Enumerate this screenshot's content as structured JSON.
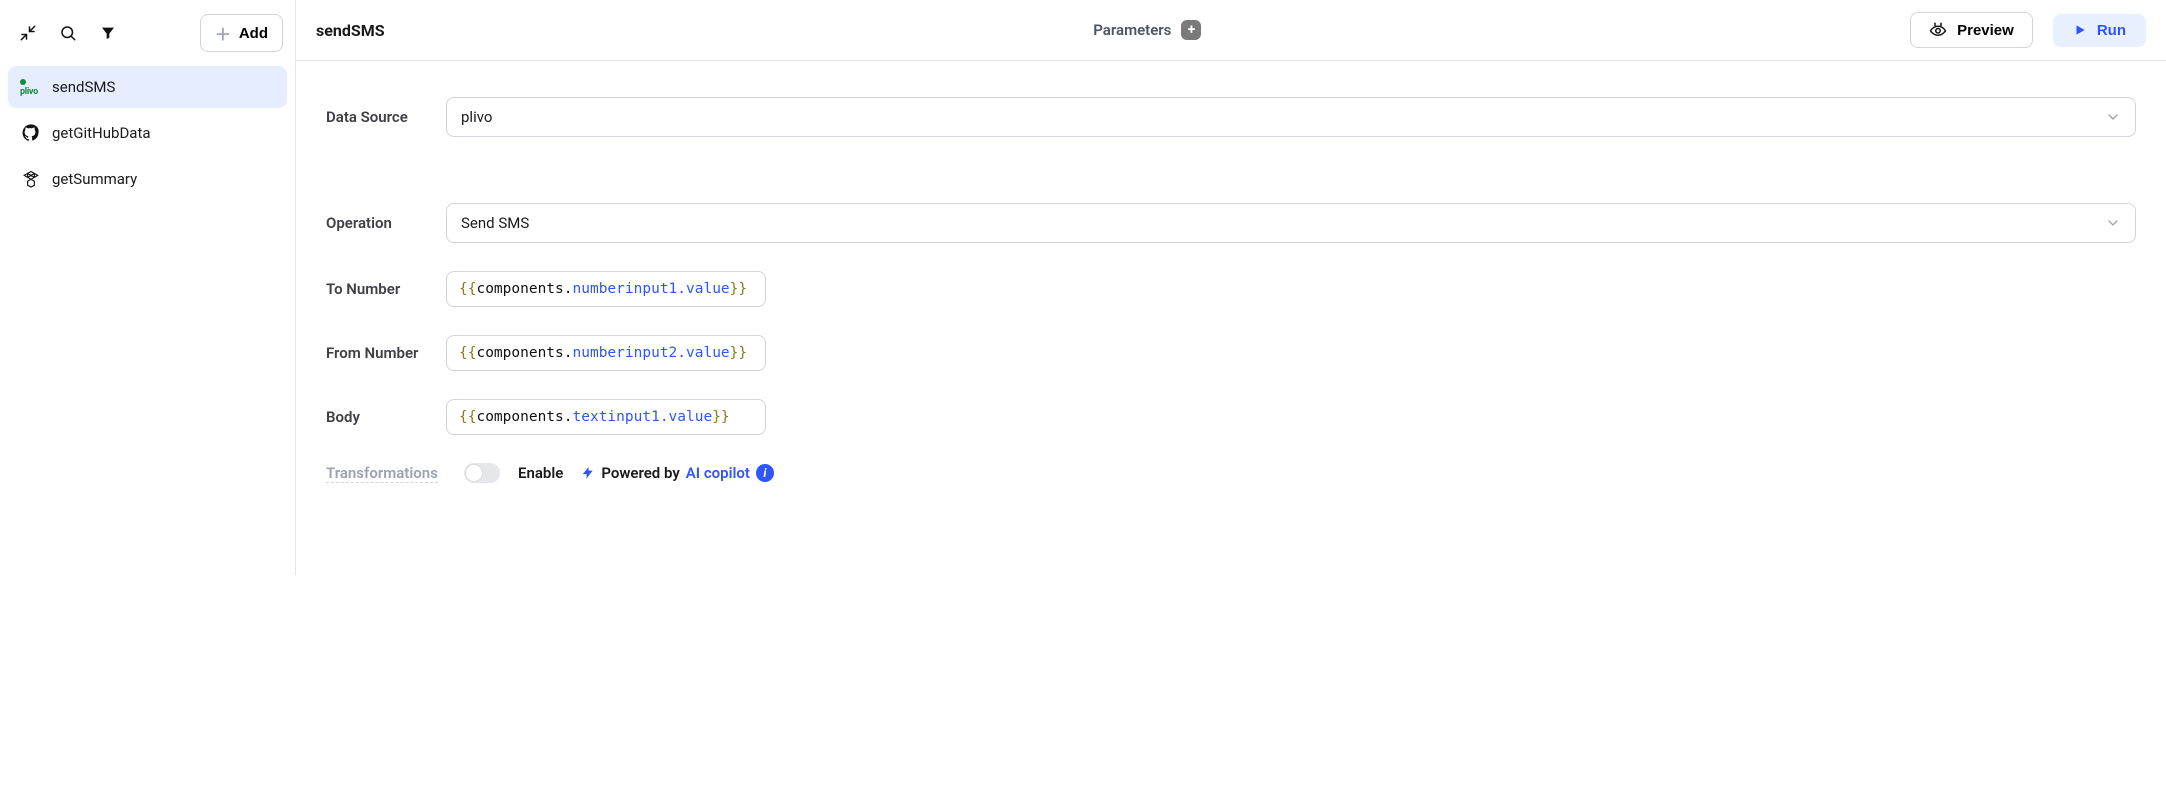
{
  "sidebar": {
    "add_label": "Add",
    "items": [
      {
        "label": "sendSMS",
        "provider": "plivo",
        "active": true
      },
      {
        "label": "getGitHubData",
        "provider": "github",
        "active": false
      },
      {
        "label": "getSummary",
        "provider": "openai",
        "active": false
      }
    ]
  },
  "header": {
    "title": "sendSMS",
    "center_label": "Parameters",
    "preview_label": "Preview",
    "run_label": "Run"
  },
  "form": {
    "datasource_label": "Data Source",
    "datasource_value": "plivo",
    "operation_label": "Operation",
    "operation_value": "Send SMS",
    "to_label": "To Number",
    "to_value": {
      "object": "components",
      "member": "numberinput1.value"
    },
    "from_label": "From Number",
    "from_value": {
      "object": "components",
      "member": "numberinput2.value"
    },
    "body_label": "Body",
    "body_value": {
      "object": "components",
      "member": "textinput1.value"
    },
    "transformations_label": "Transformations",
    "enable_label": "Enable",
    "copilot_prefix": "Powered by ",
    "copilot_link": "AI copilot"
  }
}
